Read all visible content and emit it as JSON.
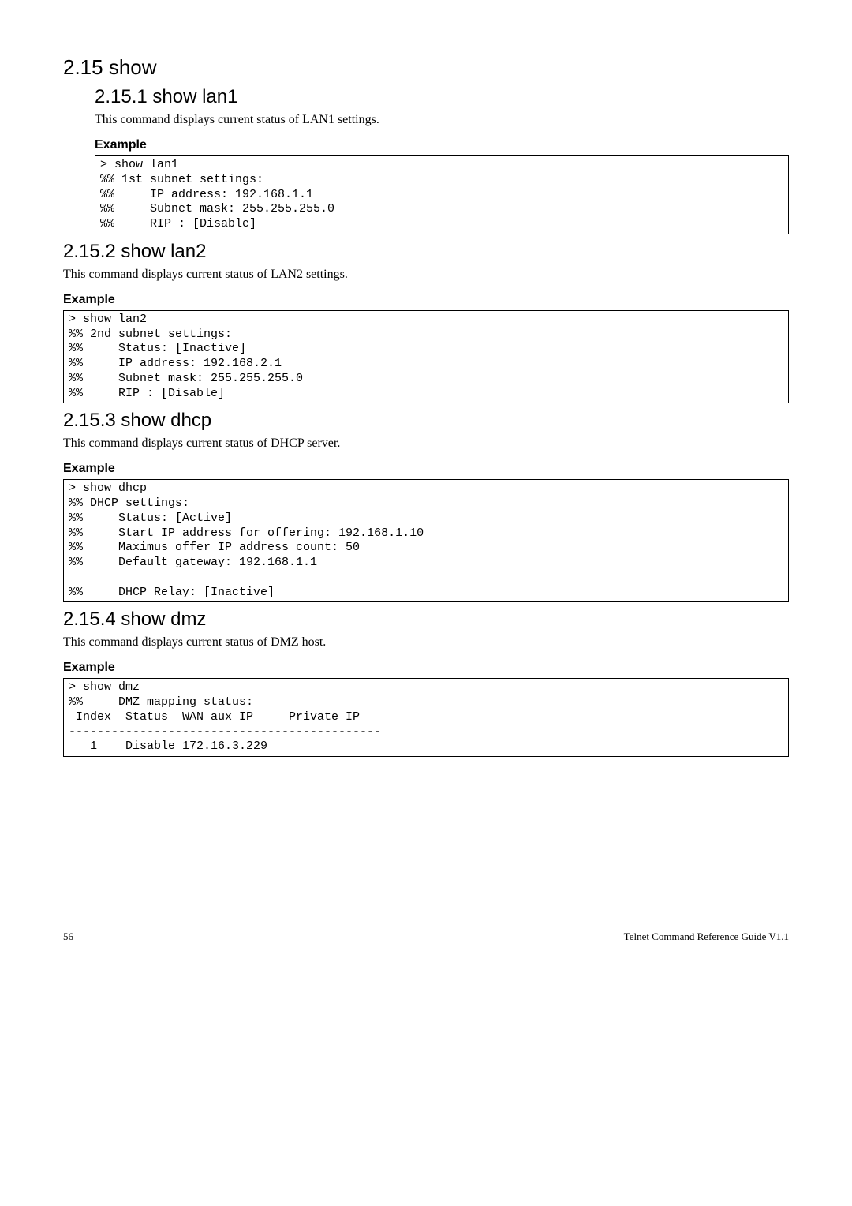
{
  "section": {
    "heading": "2.15 show",
    "subsections": [
      {
        "heading": "2.15.1 show lan1",
        "desc": "This command displays current status of LAN1 settings.",
        "example_label": "Example",
        "code": "> show lan1\n%% 1st subnet settings:\n%%     IP address: 192.168.1.1\n%%     Subnet mask: 255.255.255.0\n%%     RIP : [Disable]"
      },
      {
        "heading": "2.15.2 show lan2",
        "desc": "This command displays current status of LAN2 settings.",
        "example_label": "Example",
        "code": "> show lan2\n%% 2nd subnet settings:\n%%     Status: [Inactive]\n%%     IP address: 192.168.2.1\n%%     Subnet mask: 255.255.255.0\n%%     RIP : [Disable]"
      },
      {
        "heading": "2.15.3 show dhcp",
        "desc": "This command displays current status of DHCP server.",
        "example_label": "Example",
        "code": "> show dhcp\n%% DHCP settings:\n%%     Status: [Active]\n%%     Start IP address for offering: 192.168.1.10\n%%     Maximus offer IP address count: 50\n%%     Default gateway: 192.168.1.1\n\n%%     DHCP Relay: [Inactive]"
      },
      {
        "heading": "2.15.4 show dmz",
        "desc": "This command displays current status of DMZ host.",
        "example_label": "Example",
        "code": "> show dmz\n%%     DMZ mapping status:\n Index  Status  WAN aux IP     Private IP\n--------------------------------------------\n   1    Disable 172.16.3.229"
      }
    ]
  },
  "footer": {
    "page": "56",
    "title": "Telnet Command Reference Guide V1.1"
  }
}
